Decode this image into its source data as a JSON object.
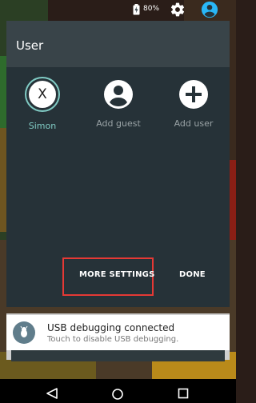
{
  "status_bar": {
    "battery_percent": "80%",
    "icons": [
      "battery-charging-icon",
      "gear-icon",
      "account-circle-icon"
    ],
    "accent": "#29b6f6"
  },
  "panel": {
    "title": "User",
    "users": [
      {
        "label": "Simon",
        "avatar_letter": "X",
        "selected": true,
        "label_color": "#80cbc4"
      },
      {
        "label": "Add guest",
        "icon": "person-icon",
        "label_color": "#9aa3a6"
      },
      {
        "label": "Add user",
        "icon": "plus-icon",
        "label_color": "#9aa3a6"
      }
    ],
    "more_settings": "MORE SETTINGS",
    "done": "DONE"
  },
  "notification": {
    "title": "USB debugging connected",
    "subtitle": "Touch to disable USB debugging.",
    "icon": "android-bug-icon"
  },
  "nav_bar": {
    "icons": [
      "back-icon",
      "home-icon",
      "recents-icon"
    ]
  }
}
